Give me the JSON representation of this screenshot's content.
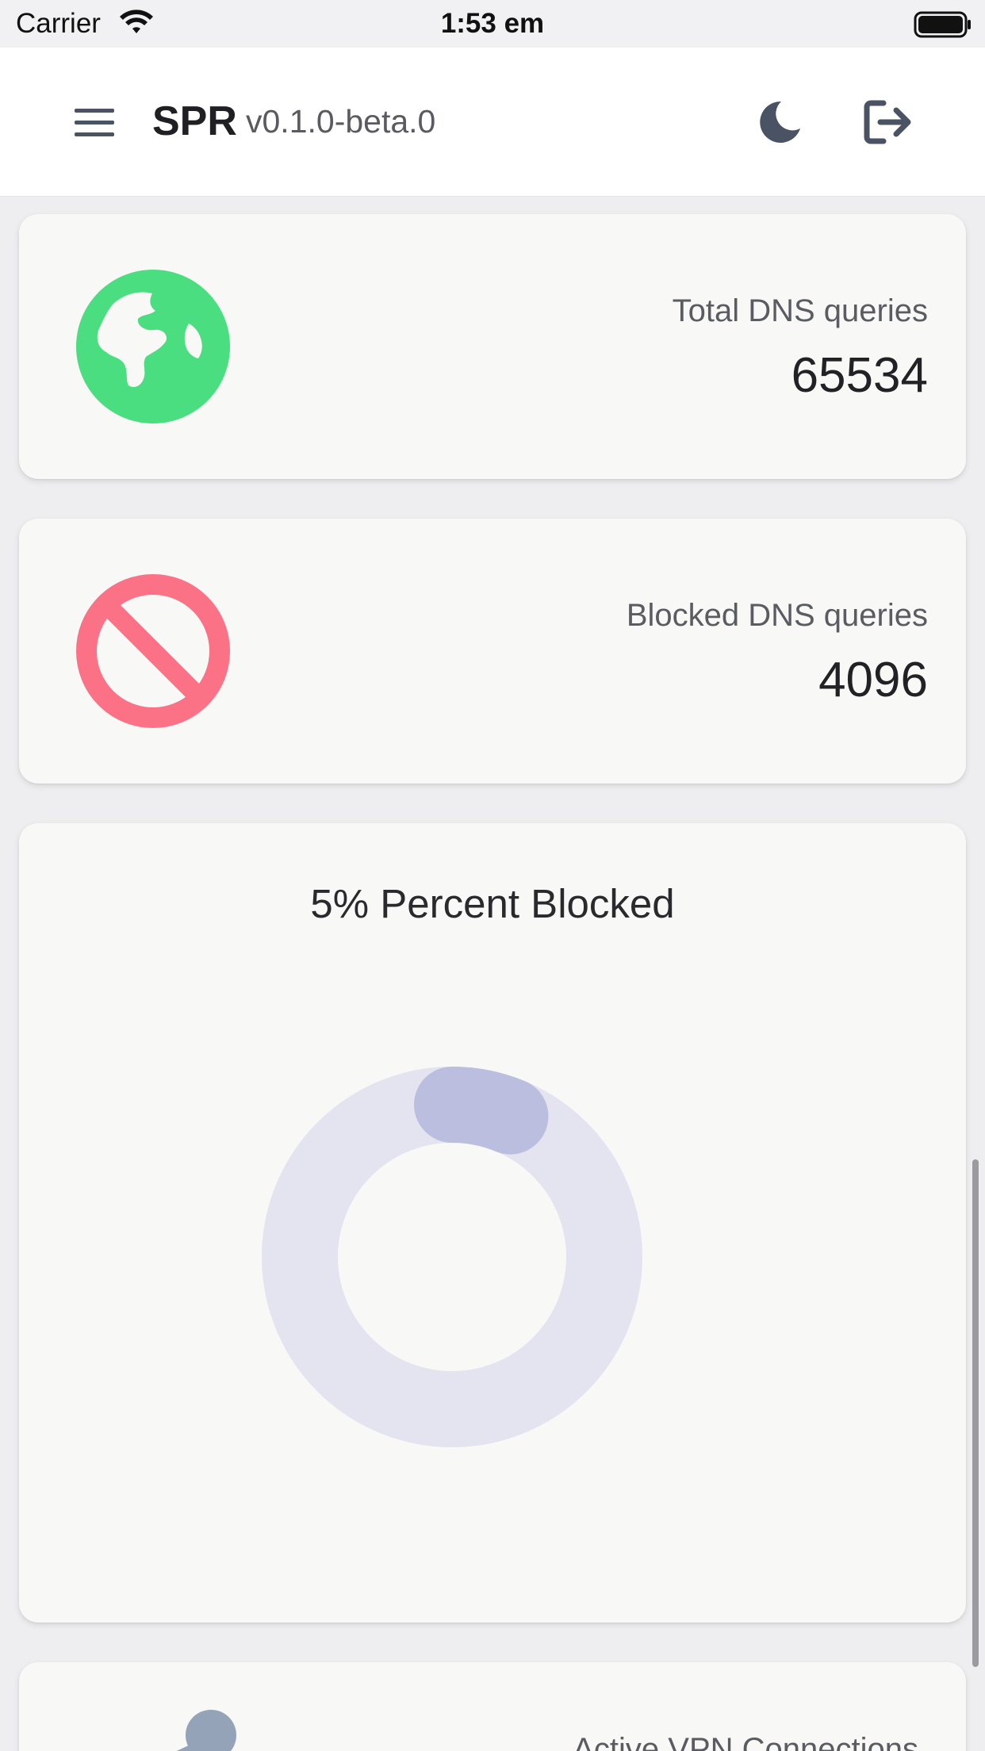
{
  "status_bar": {
    "carrier": "Carrier",
    "time": "1:53 em"
  },
  "header": {
    "title": "SPR",
    "version": "v0.1.0-beta.0",
    "menu_icon": "menu-icon",
    "theme_icon": "moon-icon",
    "logout_icon": "logout-icon"
  },
  "cards": {
    "total_dns": {
      "label": "Total DNS queries",
      "value": "65534",
      "icon": "globe-icon",
      "color": "#4ade80"
    },
    "blocked_dns": {
      "label": "Blocked DNS queries",
      "value": "4096",
      "icon": "ban-icon",
      "color": "#fb7185"
    },
    "percent_blocked": {
      "title": "5% Percent Blocked"
    },
    "vpn": {
      "label": "Active VPN Connections",
      "icon": "vpn-icon"
    }
  },
  "chart_data": {
    "type": "pie",
    "variant": "doughnut",
    "title": "5% Percent Blocked",
    "slices": [
      {
        "value": 4096,
        "color": "#bcbedf"
      },
      {
        "value": 61438,
        "color": "#e3e4ef"
      }
    ]
  }
}
